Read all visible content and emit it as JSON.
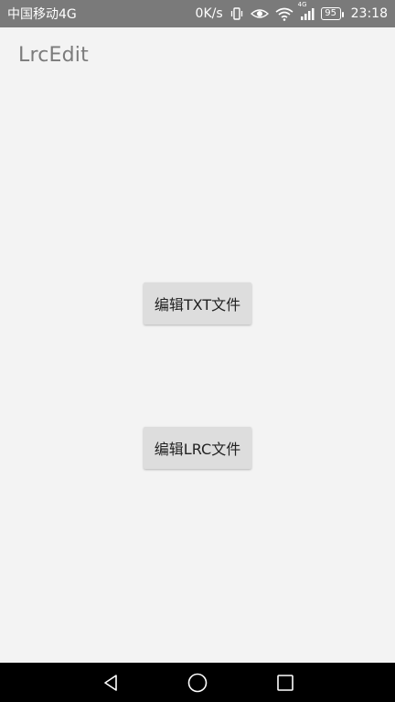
{
  "status_bar": {
    "carrier": "中国移动4G",
    "speed": "0K/s",
    "network": "4G",
    "battery": "95",
    "time": "23:18",
    "icons": [
      "vibrate-icon",
      "eye-icon",
      "wifi-icon",
      "signal-icon",
      "battery-icon"
    ]
  },
  "app": {
    "title": "LrcEdit"
  },
  "buttons": {
    "edit_txt": "编辑TXT文件",
    "edit_lrc": "编辑LRC文件"
  },
  "nav_bar": {
    "icons": [
      "back-icon",
      "home-icon",
      "recent-apps-icon"
    ]
  },
  "colors": {
    "status_bar_bg": "#7a7a7a",
    "background": "#f3f3f3",
    "button_bg": "#dddddd",
    "title_text": "#7b7b7b",
    "nav_bar_bg": "#000000"
  }
}
